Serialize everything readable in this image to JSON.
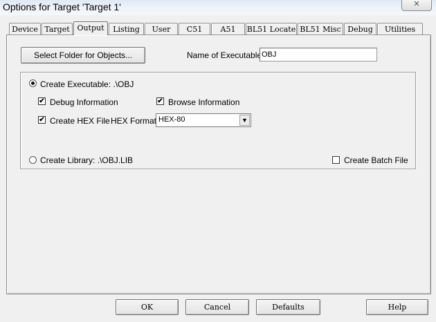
{
  "window": {
    "title": "Options for Target 'Target 1'",
    "close_label": "✕"
  },
  "tabs": [
    {
      "label": "Device"
    },
    {
      "label": "Target"
    },
    {
      "label": "Output",
      "active": true
    },
    {
      "label": "Listing"
    },
    {
      "label": "User"
    },
    {
      "label": "C51"
    },
    {
      "label": "A51"
    },
    {
      "label": "BL51 Locate"
    },
    {
      "label": "BL51 Misc"
    },
    {
      "label": "Debug"
    },
    {
      "label": "Utilities"
    }
  ],
  "output": {
    "select_folder_button": "Select Folder for Objects...",
    "executable_name_label": "Name of Executable:",
    "executable_name_value": "OBJ",
    "create_executable_label": "Create Executable:  .\\OBJ",
    "create_executable_selected": true,
    "debug_info_label": "Debug Information",
    "debug_info_checked": true,
    "browse_info_label": "Browse Information",
    "browse_info_checked": true,
    "create_hex_label": "Create HEX File",
    "create_hex_checked": true,
    "hex_format_label": "HEX Format:",
    "hex_format_value": "HEX-80",
    "create_library_label": "Create Library:  .\\OBJ.LIB",
    "create_library_selected": false,
    "batch_file_label": "Create Batch File",
    "batch_file_checked": false
  },
  "buttons": {
    "ok": "OK",
    "cancel": "Cancel",
    "defaults": "Defaults",
    "help": "Help"
  },
  "colors": {
    "dialog_bg": "#f0f0f0",
    "titlebar_bg": "#e6edf7"
  },
  "icons": {
    "checkmark": "✔",
    "dropdown": "▼"
  }
}
